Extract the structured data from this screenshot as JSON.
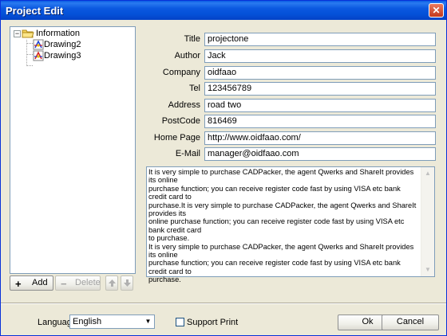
{
  "window": {
    "title": "Project Edit",
    "close_glyph": "✕"
  },
  "tree": {
    "root": {
      "label": "Information",
      "expander": "−",
      "icon": "folder-icon"
    },
    "children": [
      {
        "label": "Drawing2",
        "icon": "drawing-icon"
      },
      {
        "label": "Drawing3",
        "icon": "drawing-icon"
      }
    ]
  },
  "tree_buttons": {
    "add": {
      "icon": "+",
      "label": "Add"
    },
    "delete": {
      "icon": "−",
      "label": "Delete"
    },
    "up": "up-arrow-icon",
    "down": "down-arrow-icon"
  },
  "fields": [
    {
      "label": "Title",
      "value": "projectone"
    },
    {
      "label": "Author",
      "value": "Jack"
    },
    {
      "label": "Company",
      "value": "oidfaao"
    },
    {
      "label": "Tel",
      "value": "123456789"
    },
    {
      "label": "Address",
      "value": "road two"
    },
    {
      "label": "PostCode",
      "value": "816469"
    },
    {
      "label": "Home Page",
      "value": "http://www.oidfaao.com/"
    },
    {
      "label": "E-Mail",
      "value": "manager@oidfaao.com"
    }
  ],
  "memo": {
    "text": "It is very simple to purchase CADPacker, the agent Qwerks and ShareIt provides its online\npurchase function; you can receive register code fast by using VISA etc bank credit card to\npurchase.It is very simple to purchase CADPacker, the agent Qwerks and ShareIt provides its\nonline purchase function; you can receive register code fast by using VISA etc bank credit card\nto purchase.\nIt is very simple to purchase CADPacker, the agent Qwerks and ShareIt provides its online\npurchase function; you can receive register code fast by using VISA etc bank credit card to\npurchase."
  },
  "footer": {
    "language_label": "Language",
    "language_value": "English",
    "support_print_label": "Support Print",
    "support_print_checked": false,
    "ok_label": "Ok",
    "cancel_label": "Cancel"
  },
  "colors": {
    "titlebar": "#0451d8",
    "face": "#ece9d8",
    "border": "#7f9db9"
  }
}
